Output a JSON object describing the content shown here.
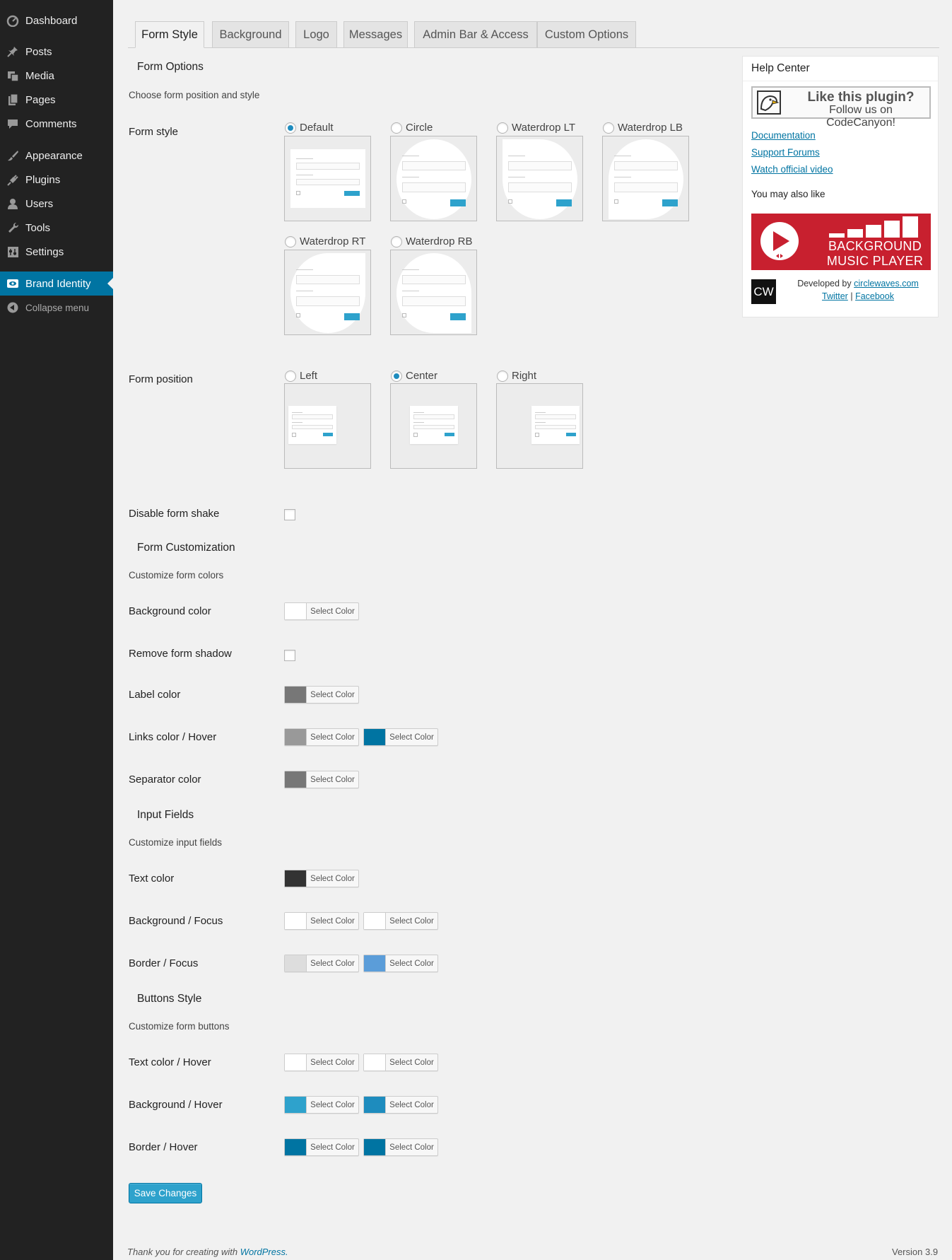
{
  "sidebar": {
    "items": [
      {
        "label": "Dashboard",
        "icon": "dashboard-icon"
      },
      {
        "label": "Posts",
        "icon": "pin-icon"
      },
      {
        "label": "Media",
        "icon": "media-icon"
      },
      {
        "label": "Pages",
        "icon": "pages-icon"
      },
      {
        "label": "Comments",
        "icon": "comment-icon"
      },
      {
        "label": "Appearance",
        "icon": "brush-icon"
      },
      {
        "label": "Plugins",
        "icon": "plug-icon"
      },
      {
        "label": "Users",
        "icon": "user-icon"
      },
      {
        "label": "Tools",
        "icon": "wrench-icon"
      },
      {
        "label": "Settings",
        "icon": "settings-icon"
      },
      {
        "label": "Brand Identity",
        "icon": "eye-icon",
        "active": true
      }
    ],
    "collapse_label": "Collapse menu"
  },
  "tabs": [
    "Form Style",
    "Background",
    "Logo",
    "Messages",
    "Admin Bar & Access",
    "Custom Options"
  ],
  "form_options": {
    "title": "Form Options",
    "description": "Choose form position and style",
    "form_style_label": "Form style",
    "styles": [
      "Default",
      "Circle",
      "Waterdrop LT",
      "Waterdrop LB",
      "Waterdrop RT",
      "Waterdrop RB"
    ],
    "selected_style": "Default",
    "form_position_label": "Form position",
    "positions": [
      "Left",
      "Center",
      "Right"
    ],
    "selected_position": "Center",
    "disable_shake_label": "Disable form shake",
    "disable_shake_checked": false
  },
  "form_customization": {
    "title": "Form Customization",
    "description": "Customize form colors",
    "rows": [
      {
        "label": "Background color",
        "colors": [
          "#ffffff"
        ]
      },
      {
        "label": "Remove form shadow",
        "checkbox": true
      },
      {
        "label": "Label color",
        "colors": [
          "#777777"
        ]
      },
      {
        "label": "Links color / Hover",
        "colors": [
          "#999999",
          "#0074a2"
        ]
      },
      {
        "label": "Separator color",
        "colors": [
          "#777777"
        ]
      }
    ]
  },
  "input_fields": {
    "title": "Input Fields",
    "description": "Customize input fields",
    "rows": [
      {
        "label": "Text color",
        "colors": [
          "#333333"
        ]
      },
      {
        "label": "Background / Focus",
        "colors": [
          "#ffffff",
          "#ffffff"
        ]
      },
      {
        "label": "Border / Focus",
        "colors": [
          "#dddddd",
          "#5b9dd9"
        ]
      }
    ]
  },
  "buttons_style": {
    "title": "Buttons Style",
    "description": "Customize form buttons",
    "rows": [
      {
        "label": "Text color / Hover",
        "colors": [
          "#ffffff",
          "#ffffff"
        ]
      },
      {
        "label": "Background / Hover",
        "colors": [
          "#2ea2cc",
          "#1e8cbe"
        ]
      },
      {
        "label": "Border / Hover",
        "colors": [
          "#0074a2",
          "#0074a2"
        ]
      }
    ]
  },
  "select_color_label": "Select Color",
  "save_label": "Save Changes",
  "help_center": {
    "title": "Help Center",
    "banner_line1": "Like this plugin?",
    "banner_line2": "Follow us on CodeCanyon!",
    "links": [
      "Documentation",
      "Support Forums",
      "Watch official video"
    ],
    "also_like": "You may also like",
    "bmp_line1": "BACKGROUND",
    "bmp_line2": "MUSIC PLAYER",
    "cw_logo": "CW",
    "developed_by": "Developed by",
    "dev_link": "circlewaves.com",
    "twitter": "Twitter",
    "separator": "|",
    "facebook": "Facebook"
  },
  "footer": {
    "thanks": "Thank you for creating with",
    "wordpress": "WordPress.",
    "version": "Version 3.9"
  },
  "colors": {
    "accent": "#0074a2",
    "button": "#2ea2cc",
    "sidebar_bg": "#222222",
    "bmp_red": "#c8202f"
  }
}
